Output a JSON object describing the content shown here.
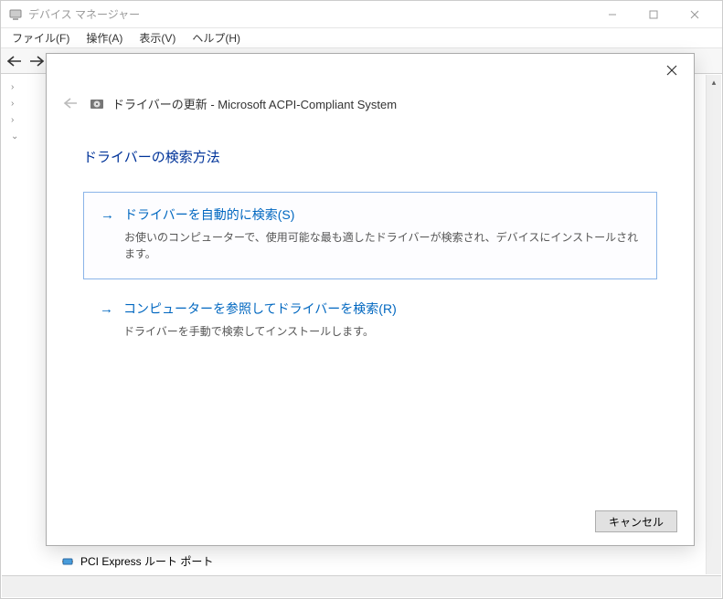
{
  "dm": {
    "title": "デバイス マネージャー",
    "menu": {
      "file": "ファイル(F)",
      "action": "操作(A)",
      "view": "表示(V)",
      "help": "ヘルプ(H)"
    },
    "tree": {
      "expand_glyphs": [
        "›",
        "›",
        "›",
        "⌄"
      ],
      "visible_item_label": "PCI Express ルート ポート"
    }
  },
  "dialog": {
    "title": "ドライバーの更新 - Microsoft ACPI-Compliant System",
    "heading": "ドライバーの検索方法",
    "option1": {
      "title": "ドライバーを自動的に検索(S)",
      "desc": "お使いのコンピューターで、使用可能な最も適したドライバーが検索され、デバイスにインストールされます。"
    },
    "option2": {
      "title": "コンピューターを参照してドライバーを検索(R)",
      "desc": "ドライバーを手動で検索してインストールします。"
    },
    "cancel": "キャンセル"
  }
}
